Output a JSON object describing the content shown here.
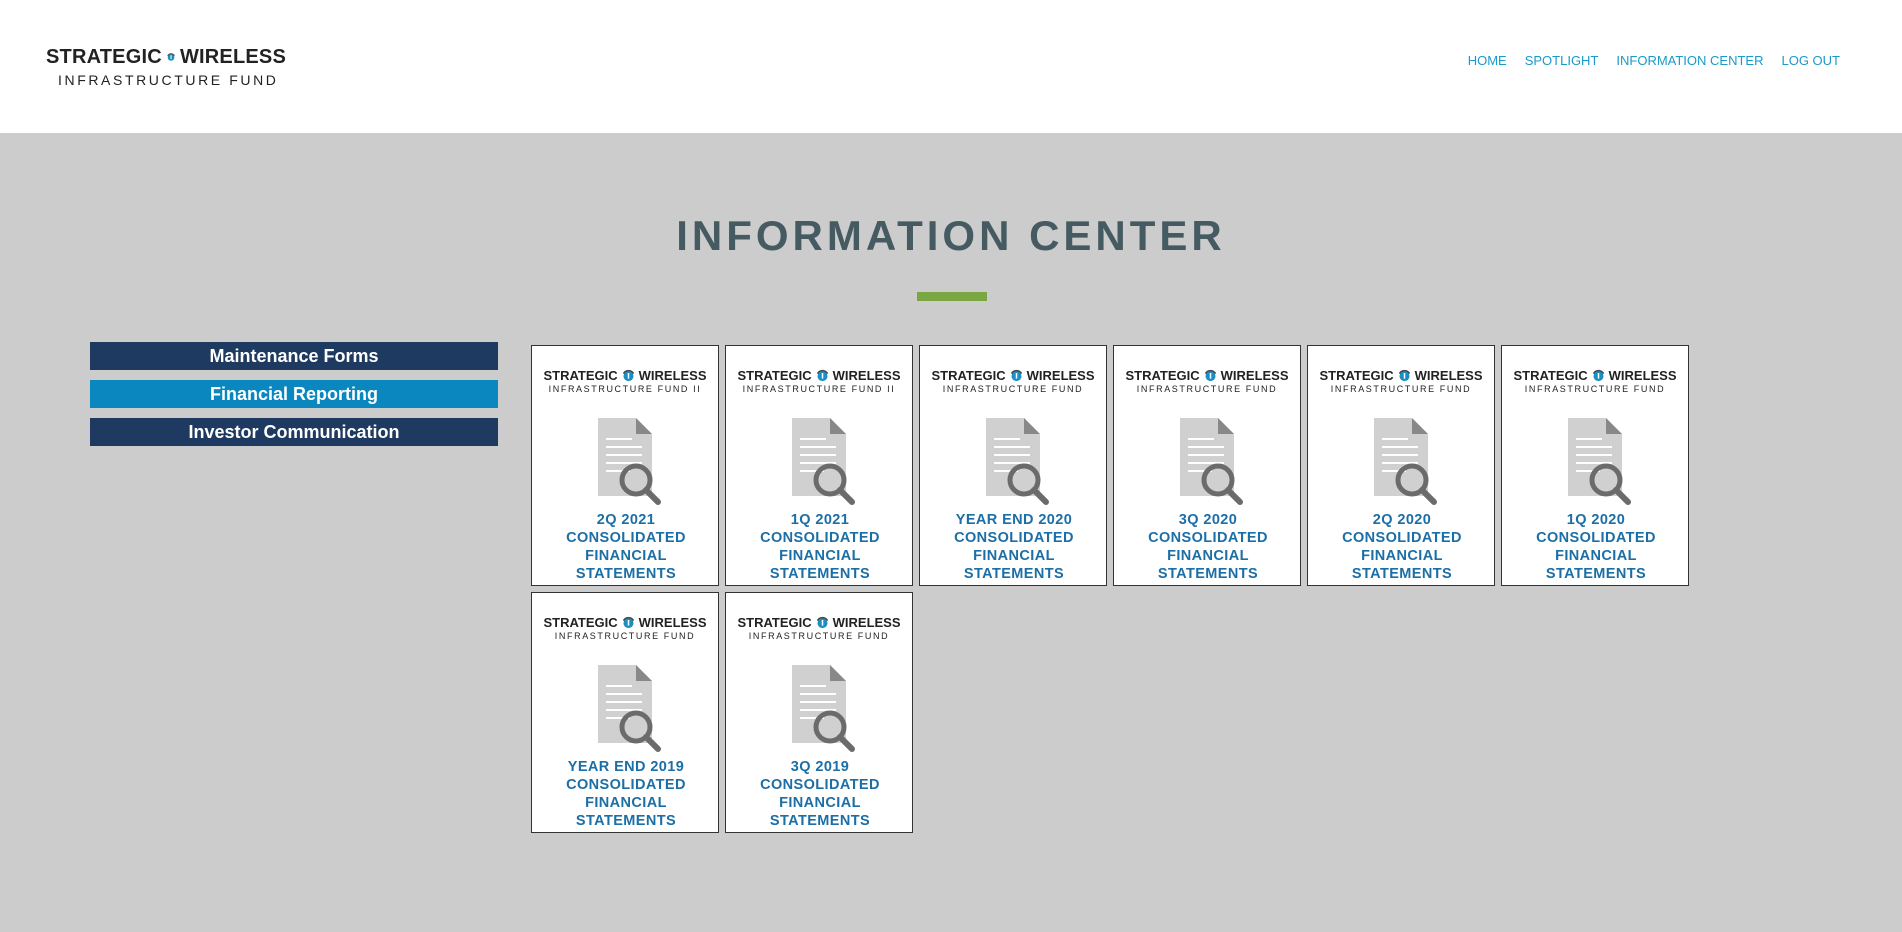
{
  "header": {
    "logo": {
      "line1_left": "STRATEGIC",
      "line1_right": "WIRELESS",
      "line2": "INFRASTRUCTURE FUND"
    },
    "nav": [
      "HOME",
      "SPOTLIGHT",
      "INFORMATION CENTER",
      "LOG OUT"
    ]
  },
  "main": {
    "title": "INFORMATION CENTER",
    "sidebar": [
      {
        "label": "Maintenance Forms"
      },
      {
        "label": "Financial Reporting"
      },
      {
        "label": "Investor Communication"
      }
    ],
    "cards": [
      {
        "brand_left": "STRATEGIC",
        "brand_right": "WIRELESS",
        "fund": "INFRASTRUCTURE FUND II",
        "title": "2Q 2021 CONSOLIDATED FINANCIAL STATEMENTS"
      },
      {
        "brand_left": "STRATEGIC",
        "brand_right": "WIRELESS",
        "fund": "INFRASTRUCTURE FUND II",
        "title": "1Q 2021 CONSOLIDATED FINANCIAL STATEMENTS"
      },
      {
        "brand_left": "STRATEGIC",
        "brand_right": "WIRELESS",
        "fund": "INFRASTRUCTURE FUND",
        "title": "YEAR END 2020 CONSOLIDATED FINANCIAL STATEMENTS"
      },
      {
        "brand_left": "STRATEGIC",
        "brand_right": "WIRELESS",
        "fund": "INFRASTRUCTURE FUND",
        "title": "3Q 2020 CONSOLIDATED FINANCIAL STATEMENTS"
      },
      {
        "brand_left": "STRATEGIC",
        "brand_right": "WIRELESS",
        "fund": "INFRASTRUCTURE FUND",
        "title": "2Q 2020 CONSOLIDATED FINANCIAL STATEMENTS"
      },
      {
        "brand_left": "STRATEGIC",
        "brand_right": "WIRELESS",
        "fund": "INFRASTRUCTURE FUND",
        "title": "1Q 2020 CONSOLIDATED FINANCIAL STATEMENTS"
      },
      {
        "brand_left": "STRATEGIC",
        "brand_right": "WIRELESS",
        "fund": "INFRASTRUCTURE FUND",
        "title": "YEAR END 2019 CONSOLIDATED FINANCIAL STATEMENTS"
      },
      {
        "brand_left": "STRATEGIC",
        "brand_right": "WIRELESS",
        "fund": "INFRASTRUCTURE FUND",
        "title": "3Q 2019 CONSOLIDATED FINANCIAL STATEMENTS"
      }
    ]
  },
  "colors": {
    "nav_link": "#1a9ac9",
    "sidebar_dark": "#1f3a60",
    "sidebar_active": "#0a87bf",
    "title_rule": "#7ba743",
    "card_title": "#1b6ea6"
  },
  "icons": {
    "card": "document-search-icon",
    "logo": "globe-signal-icon"
  }
}
